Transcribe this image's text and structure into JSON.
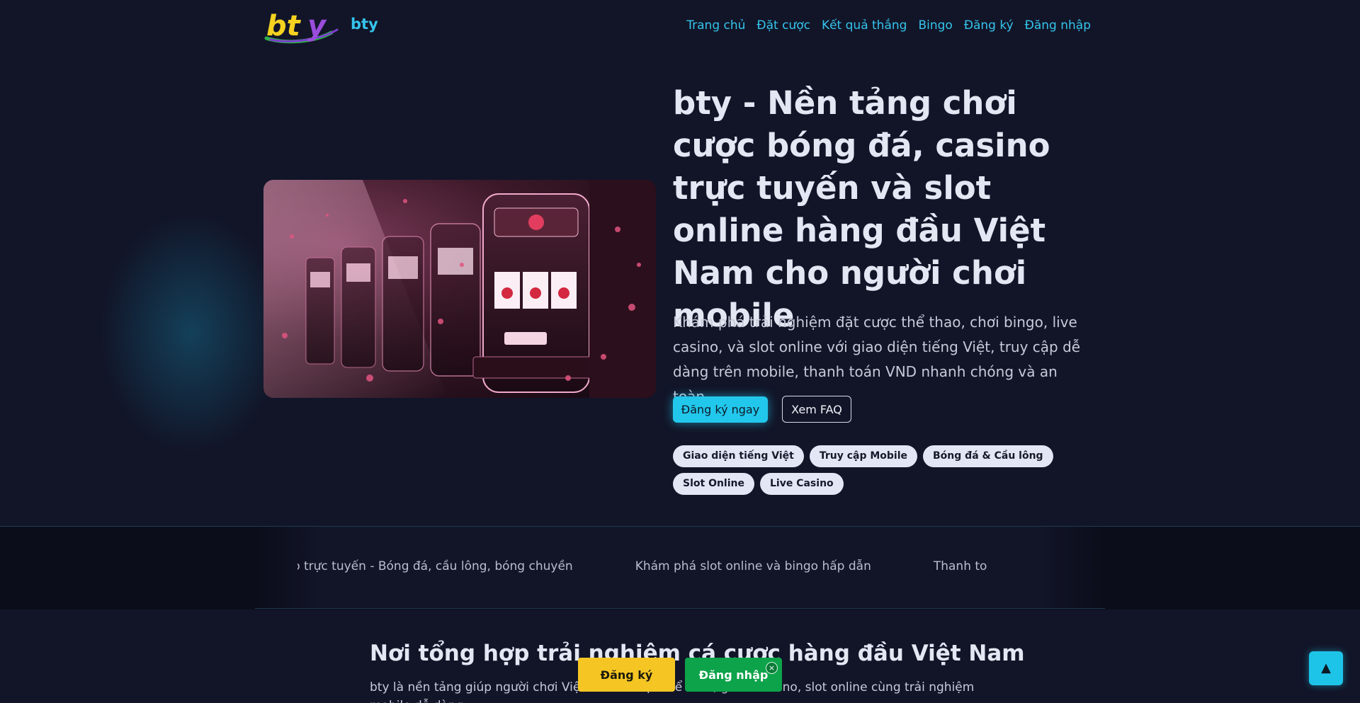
{
  "header": {
    "brand": "bty",
    "nav": [
      "Trang chủ",
      "Đặt cược",
      "Kết quả thắng",
      "Bingo",
      "Đăng ký",
      "Đăng nhập"
    ]
  },
  "hero": {
    "title": "bty - Nền tảng chơi cược bóng đá, casino trực tuyến và slot online hàng đầu Việt Nam cho người chơi mobile",
    "description": "Khám phá trải nghiệm đặt cược thể thao, chơi bingo, live casino, và slot online với giao diện tiếng Việt, truy cập dễ dàng trên mobile, thanh toán VND nhanh chóng và an toàn.",
    "primary_button": "Đăng ký ngay",
    "secondary_button": "Xem FAQ",
    "tags": [
      "Giao diện tiếng Việt",
      "Truy cập Mobile",
      "Bóng đá & Cầu lông",
      "Slot Online",
      "Live Casino"
    ]
  },
  "marquee": [
    "hao trực tuyến - Bóng đá, cầu lông, bóng chuyền",
    "Khám phá slot online và bingo hấp dẫn",
    "Thanh toán VND r"
  ],
  "section": {
    "title": "Nơi tổng hợp trải nghiệm cá cược hàng đầu Việt Nam",
    "text": "bty là nền tảng giúp người chơi Việt nh                                   n v                cược thể thao, game casino, slot online cùng trải nghiệm mobile dễ dàng."
  },
  "floating": {
    "register": "Đăng ký",
    "login": "Đăng nhập",
    "close": "×",
    "back_to_top": "▲"
  },
  "colors": {
    "background": "#121528",
    "accent": "#22c7ec",
    "register": "#f5c623",
    "login": "#0da34a"
  }
}
